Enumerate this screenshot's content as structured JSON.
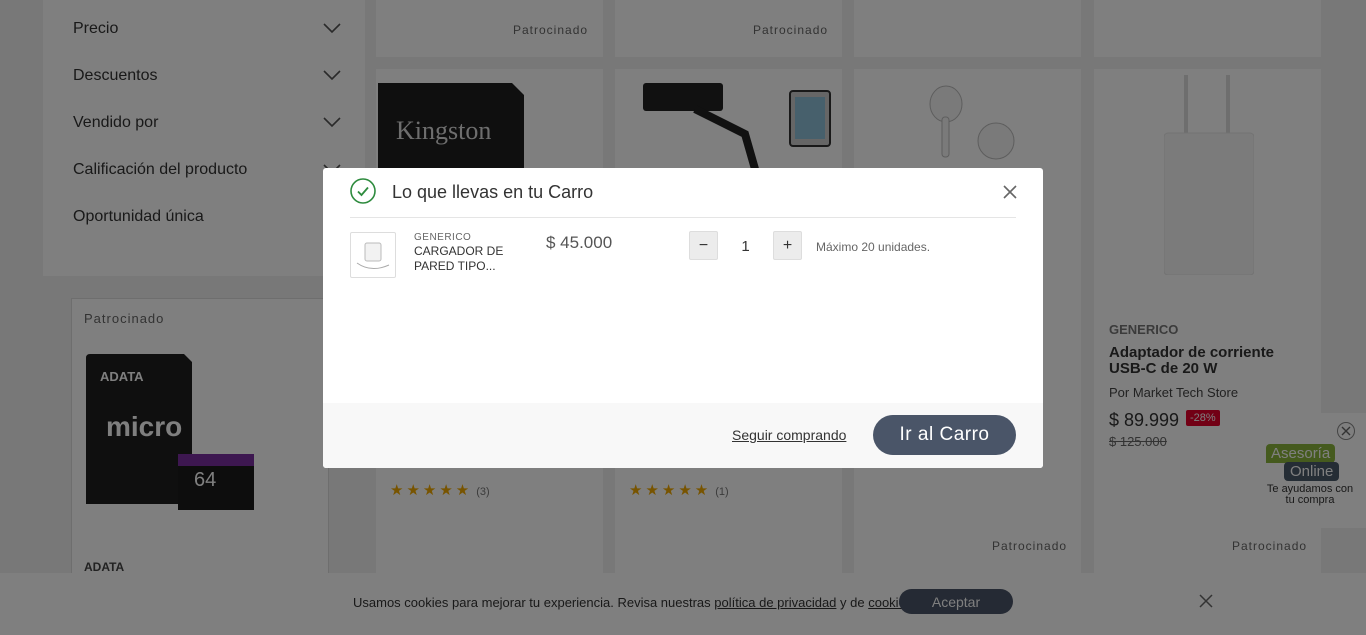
{
  "filters": [
    {
      "label": "Precio"
    },
    {
      "label": "Descuentos"
    },
    {
      "label": "Vendido por"
    },
    {
      "label": "Calificación del producto"
    },
    {
      "label": "Oportunidad única"
    }
  ],
  "sponsored_label": "Patrocinado",
  "products": {
    "adata": {
      "sponsored": "Patrocinado",
      "brand": "ADATA",
      "card_brand_text": "ADATA",
      "size_text": "64"
    },
    "kingston": {
      "rating_count": "(3)",
      "logo_text": "Kingston"
    },
    "stand": {
      "rating_count": "(1)"
    },
    "adapter": {
      "brand": "GENERICO",
      "name": "Adaptador de corriente USB-C de 20 W",
      "seller": "Por Market Tech Store",
      "price": "$ 89.999",
      "discount": "-28%",
      "old_price": "$ 125.000"
    }
  },
  "rating_stars": "★★★★★",
  "cookie": {
    "text_before": "Usamos cookies para mejorar tu experiencia. Revisa nuestras ",
    "privacy_link": "política de privacidad",
    "text_middle": " y de ",
    "cookies_link": "cookies",
    "text_after": ".",
    "accept_label": "Aceptar"
  },
  "chat": {
    "logo_line1": "Asesoría",
    "logo_line2": "Online",
    "subtitle": "Te ayudamos con tu compra"
  },
  "modal": {
    "title": "Lo que llevas en tu Carro",
    "item": {
      "brand": "GENERICO",
      "name": "CARGADOR DE PARED TIPO...",
      "price": "$ 45.000",
      "quantity": "1",
      "max_note": "Máximo 20 unidades."
    },
    "minus_label": "−",
    "plus_label": "+",
    "continue_label": "Seguir comprando",
    "go_cart_label": "Ir al Carro"
  },
  "colors": {
    "primary_button": "#4a5568",
    "discount": "#e4002b",
    "success": "#2e8b3e",
    "stars": "#f1a800"
  }
}
